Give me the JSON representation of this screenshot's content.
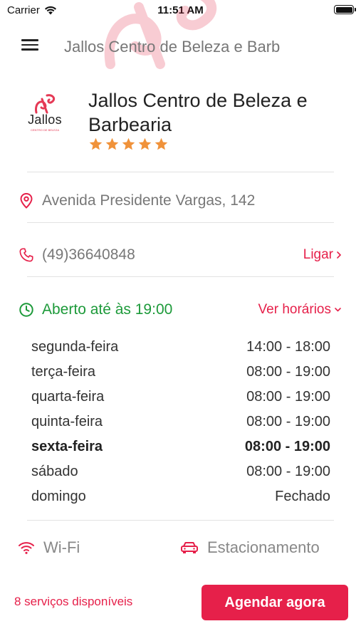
{
  "status_bar": {
    "carrier": "Carrier",
    "time": "11:51 AM"
  },
  "nav": {
    "title": "Jallos Centro de Beleza e Barb"
  },
  "business": {
    "logo_text": "Jallos",
    "logo_subtext": "CENTRO DE BELEZA",
    "name": "Jallos Centro de Beleza e Barbearia",
    "rating": 5
  },
  "address": "Avenida Presidente Vargas, 142",
  "phone": {
    "number": "(49)36640848",
    "call_label": "Ligar"
  },
  "opening": {
    "status": "Aberto até às 19:00",
    "toggle_label": "Ver horários"
  },
  "hours": [
    {
      "day": "segunda-feira",
      "time": "14:00 - 18:00",
      "today": false
    },
    {
      "day": "terça-feira",
      "time": "08:00 - 19:00",
      "today": false
    },
    {
      "day": "quarta-feira",
      "time": "08:00 - 19:00",
      "today": false
    },
    {
      "day": "quinta-feira",
      "time": "08:00 - 19:00",
      "today": false
    },
    {
      "day": "sexta-feira",
      "time": "08:00 - 19:00",
      "today": true
    },
    {
      "day": "sábado",
      "time": "08:00 - 19:00",
      "today": false
    },
    {
      "day": "domingo",
      "time": "Fechado",
      "today": false
    }
  ],
  "amenities": {
    "wifi_label": "Wi-Fi",
    "parking_label": "Estacionamento"
  },
  "footer": {
    "services_label": "8 serviços disponíveis",
    "book_label": "Agendar agora"
  },
  "colors": {
    "accent": "#e6204a",
    "open_green": "#1d9a3a",
    "star": "#f0923a"
  },
  "icons": [
    "wifi-signal-icon",
    "battery-icon",
    "menu-icon",
    "location-pin-icon",
    "phone-icon",
    "clock-icon",
    "chevron-right-icon",
    "chevron-down-icon",
    "wifi-icon",
    "car-icon",
    "star-icon"
  ]
}
